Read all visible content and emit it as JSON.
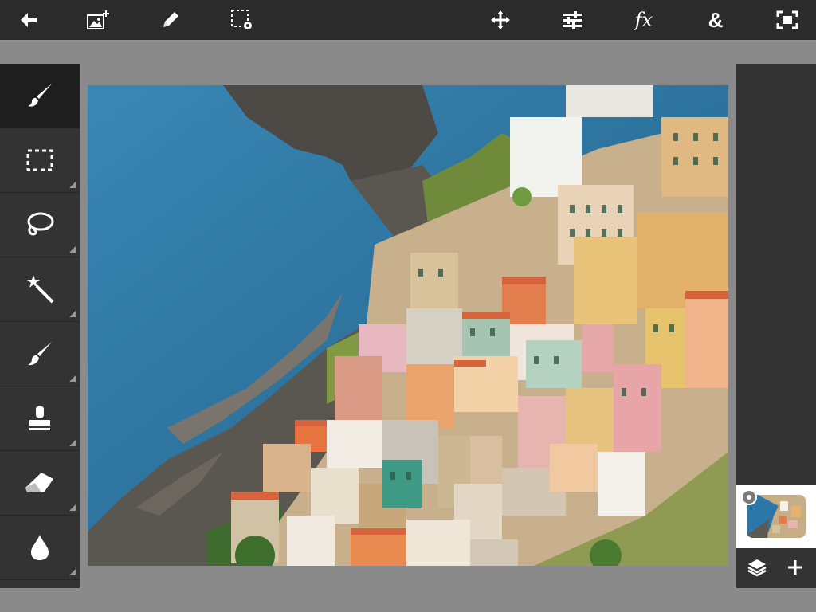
{
  "toolbar": {
    "icons": [
      "back-arrow-icon",
      "add-image-icon",
      "pencil-icon",
      "selection-settings-icon",
      "move-icon",
      "adjustments-icon",
      "fx-icon",
      "blend-icon",
      "fit-screen-icon"
    ],
    "fx_label": "fx",
    "blend_label": "&"
  },
  "tools": {
    "items": [
      {
        "name": "brush-tool",
        "icon": "brush-icon",
        "active": true
      },
      {
        "name": "rectangle-select-tool",
        "icon": "marquee-icon",
        "active": false
      },
      {
        "name": "lasso-tool",
        "icon": "lasso-icon",
        "active": false
      },
      {
        "name": "magic-wand-tool",
        "icon": "magic-wand-icon",
        "active": false
      },
      {
        "name": "paint-brush-tool",
        "icon": "paintbrush-icon",
        "active": false
      },
      {
        "name": "clone-stamp-tool",
        "icon": "stamp-icon",
        "active": false
      },
      {
        "name": "eraser-tool",
        "icon": "eraser-icon",
        "active": false
      },
      {
        "name": "blur-tool",
        "icon": "drop-icon",
        "active": false
      }
    ]
  },
  "canvas": {
    "image": "coastal-village-photo"
  },
  "layers": {
    "thumbnail": "layer-1-thumbnail",
    "icons": [
      "layers-icon",
      "plus-icon"
    ]
  },
  "colors": {
    "toolbar_bg": "#2b2b2b",
    "panel_bg": "#333333",
    "workspace_bg": "#8a8a8a",
    "active_tool_bg": "#1e1e1e",
    "icon": "#ffffff"
  }
}
